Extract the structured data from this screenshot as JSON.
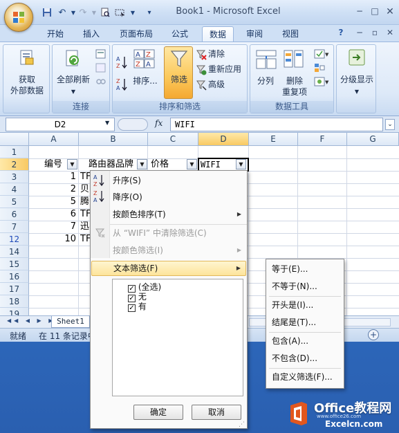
{
  "window": {
    "title": "Book1 - Microsoft Excel"
  },
  "tabs": [
    "开始",
    "插入",
    "页面布局",
    "公式",
    "数据",
    "审阅",
    "视图"
  ],
  "active_tab": "数据",
  "ribbon": {
    "get_external": [
      "获取",
      "外部数据"
    ],
    "refresh_all": "全部刷新",
    "group_connections": "连接",
    "sort_label": "排序...",
    "filter_label": "筛选",
    "clear_label": "清除",
    "reapply_label": "重新应用",
    "advanced_label": "高级",
    "group_sort_filter": "排序和筛选",
    "text_to_columns": "分列",
    "remove_duplicates": [
      "删除",
      "重复项"
    ],
    "group_data_tools": "数据工具",
    "outline": "分级显示"
  },
  "formula_bar": {
    "name_box": "D2",
    "fx": "fx",
    "value": "WIFI"
  },
  "grid": {
    "columns": [
      "A",
      "B",
      "C",
      "D",
      "E",
      "F",
      "G"
    ],
    "rows": [
      "1",
      "2",
      "3",
      "4",
      "5",
      "6",
      "7",
      "12",
      "14",
      "15",
      "16",
      "17",
      "18",
      "19"
    ],
    "header_row": {
      "a": "编号",
      "b": "路由器品牌",
      "c": "价格",
      "d": "WIFI"
    },
    "data_rows": [
      {
        "a": "1",
        "b": "TF"
      },
      {
        "a": "2",
        "b": "贝"
      },
      {
        "a": "5",
        "b": "腾"
      },
      {
        "a": "6",
        "b": "TF"
      },
      {
        "a": "7",
        "b": "迅"
      },
      {
        "a": "10",
        "b": "TF"
      }
    ]
  },
  "sheet_tab": "Sheet1",
  "status": {
    "ready": "就绪",
    "found": "在 11 条记录中"
  },
  "filter_menu": {
    "sort_asc": "升序(S)",
    "sort_desc": "降序(O)",
    "sort_by_color": "按颜色排序(T)",
    "clear_filter": "从 “WIFI” 中清除筛选(C)",
    "filter_by_color": "按颜色筛选(I)",
    "text_filters": "文本筛选(F)",
    "values": [
      {
        "label": "(全选)",
        "checked": true
      },
      {
        "label": "无",
        "checked": true
      },
      {
        "label": "有",
        "checked": true
      }
    ],
    "ok": "确定",
    "cancel": "取消"
  },
  "text_filter_submenu": {
    "equals": "等于(E)...",
    "not_equals": "不等于(N)...",
    "begins_with": "开头是(I)...",
    "ends_with": "结尾是(T)...",
    "contains": "包含(A)...",
    "not_contains": "不包含(D)...",
    "custom": "自定义筛选(F)..."
  },
  "watermark": {
    "brand": "Office教程网",
    "url": "www.office26.com",
    "site": "Excelcn.com"
  }
}
